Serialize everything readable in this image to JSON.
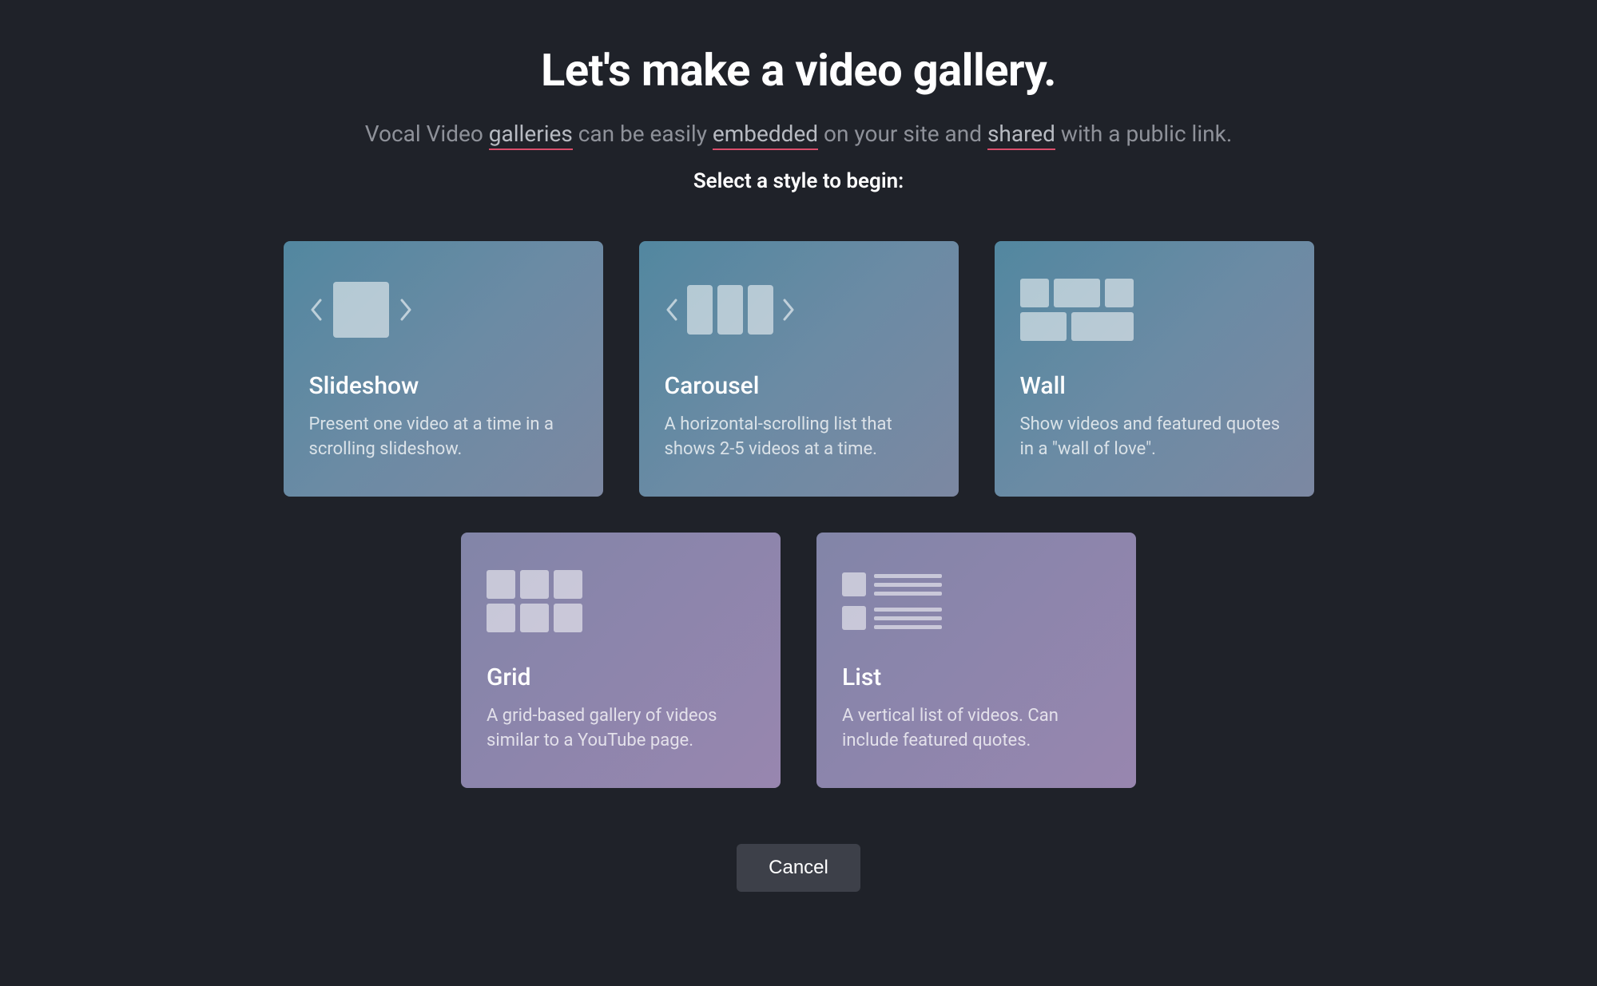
{
  "header": {
    "title": "Let's make a video gallery.",
    "subtitle_parts": {
      "prefix": "Vocal Video ",
      "link1": "galleries",
      "mid1": " can be easily ",
      "link2": "embedded",
      "mid2": " on your site and ",
      "link3": "shared",
      "suffix": " with a public link."
    },
    "select_prompt": "Select a style to begin:"
  },
  "cards": {
    "slideshow": {
      "title": "Slideshow",
      "description": "Present one video at a time in a scrolling slideshow."
    },
    "carousel": {
      "title": "Carousel",
      "description": "A horizontal-scrolling list that shows 2-5 videos at a time."
    },
    "wall": {
      "title": "Wall",
      "description": "Show videos and featured quotes in a \"wall of love\"."
    },
    "grid": {
      "title": "Grid",
      "description": "A grid-based gallery of videos similar to a YouTube page."
    },
    "list": {
      "title": "List",
      "description": "A vertical list of videos. Can include featured quotes."
    }
  },
  "actions": {
    "cancel": "Cancel"
  }
}
